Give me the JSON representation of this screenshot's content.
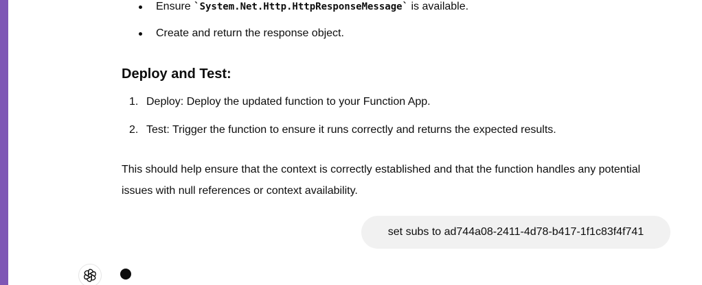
{
  "conversation": {
    "bullets": [
      {
        "prefix": "Ensure ",
        "code": "`System.Net.Http.HttpResponseMessage`",
        "suffix": " is available."
      },
      {
        "text": "Create and return the response object."
      }
    ],
    "section_heading": "Deploy and Test:",
    "steps": [
      {
        "number": "1.",
        "text": "Deploy: Deploy the updated function to your Function App."
      },
      {
        "number": "2.",
        "text": "Test: Trigger the function to ensure it runs correctly and returns the expected results."
      }
    ],
    "closing_paragraph": "This should help ensure that the context is correctly established and that the function handles any potential issues with null references or context availability.",
    "user_message": "set subs to ad744a08-2411-4d78-b417-1f1c83f4f741"
  },
  "colors": {
    "sidebar_accent": "#7e57b5",
    "user_bubble_bg": "#f1f1f1",
    "text": "#0d0d0d"
  },
  "icons": {
    "assistant_avatar": "openai-logo-icon",
    "typing_indicator": "typing-dot-icon"
  }
}
